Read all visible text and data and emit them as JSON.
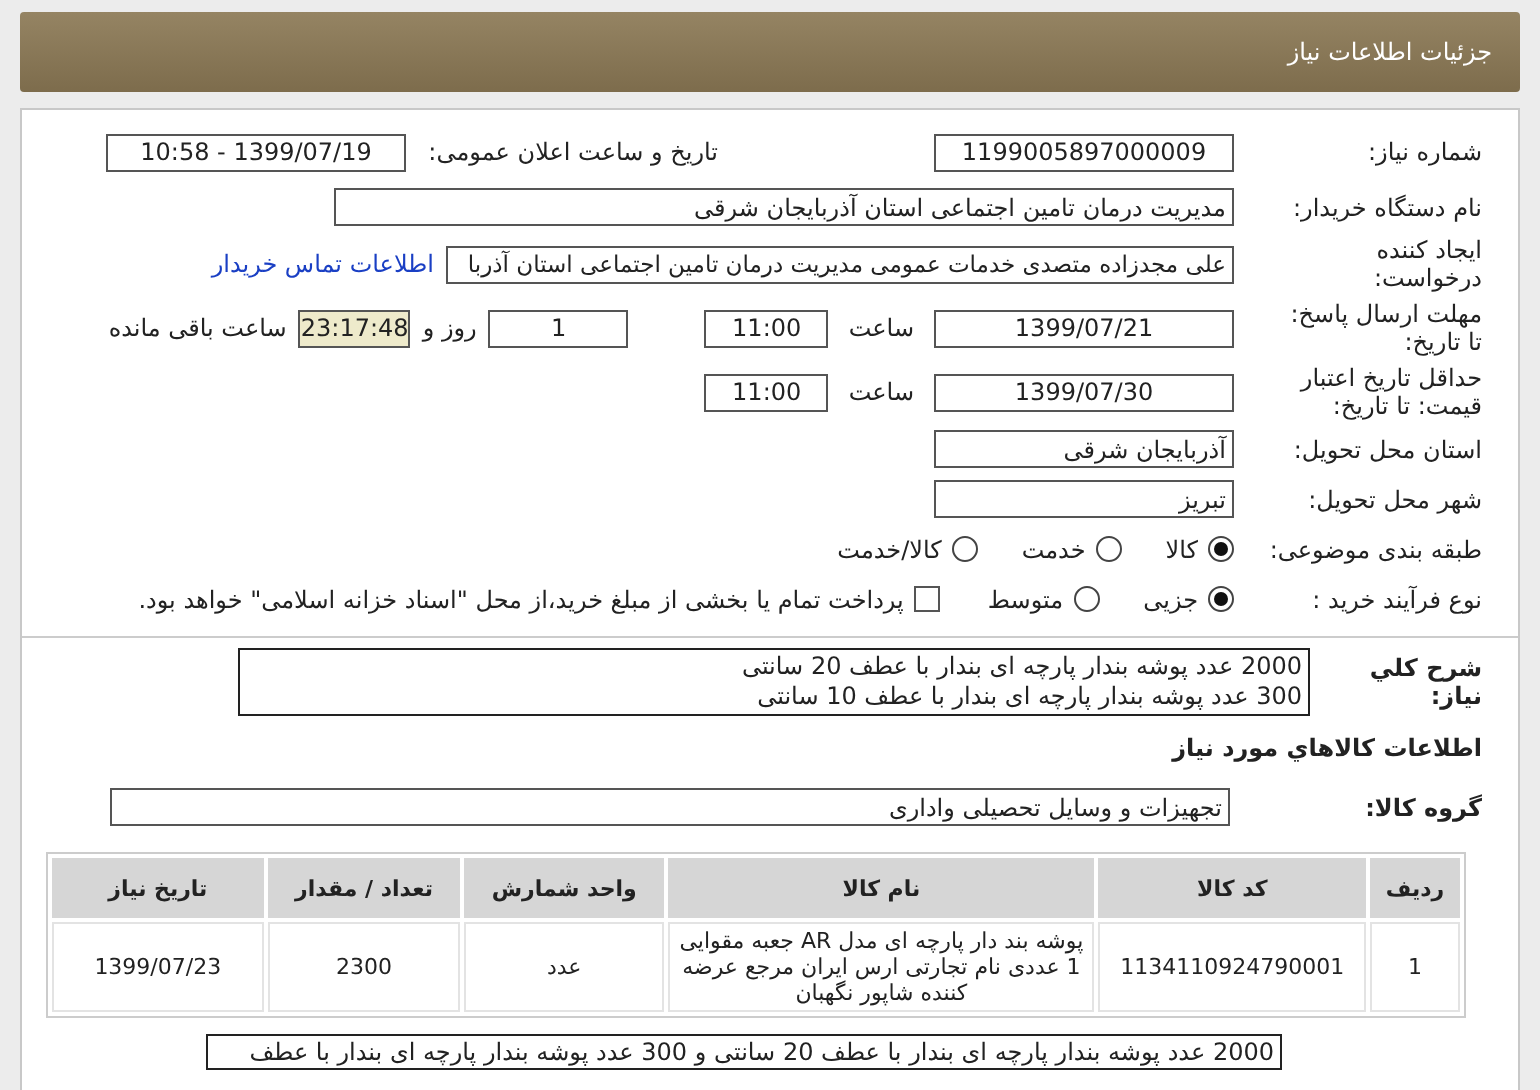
{
  "header": {
    "title": "جزئیات اطلاعات نیاز"
  },
  "need_number": {
    "label": "شماره نیاز:",
    "value": "1199005897000009"
  },
  "announce": {
    "label": "تاریخ و ساعت اعلان عمومی:",
    "value": "1399/07/19 - 10:58"
  },
  "buyer": {
    "label": "نام دستگاه خریدار:",
    "value": "مدیریت درمان تامین اجتماعی استان آذربایجان شرقی"
  },
  "creator": {
    "label_lines": [
      "ایجاد کننده",
      "درخواست:"
    ],
    "value": "علی مجدزاده متصدی خدمات عمومی مدیریت درمان تامین اجتماعی استان آذربا",
    "link": "اطلاعات تماس خریدار"
  },
  "deadline": {
    "label_lines": [
      "مهلت ارسال پاسخ:",
      "تا تاریخ:"
    ],
    "date": "1399/07/21",
    "time_label": "ساعت",
    "time": "11:00",
    "days": "1",
    "days_label": "روز و",
    "remaining": "23:17:48",
    "remaining_label": "ساعت باقی مانده"
  },
  "validity": {
    "label_lines": [
      "حداقل تاریخ اعتبار",
      "قیمت: تا تاریخ:"
    ],
    "date": "1399/07/30",
    "time_label": "ساعت",
    "time": "11:00"
  },
  "province": {
    "label": "استان محل تحویل:",
    "value": "آذربایجان شرقی"
  },
  "city": {
    "label": "شهر محل تحویل:",
    "value": "تبریز"
  },
  "category": {
    "label": "طبقه بندی موضوعی:",
    "options": [
      {
        "label": "کالا",
        "selected": true
      },
      {
        "label": "خدمت",
        "selected": false
      },
      {
        "label": "کالا/خدمت",
        "selected": false
      }
    ]
  },
  "process": {
    "label": "نوع فرآیند خرید :",
    "options": [
      {
        "label": "جزیی",
        "selected": true
      },
      {
        "label": "متوسط",
        "selected": false
      }
    ],
    "treasury": {
      "label": "پرداخت تمام یا بخشی از مبلغ خرید،از محل \"اسناد خزانه اسلامی\" خواهد بود.",
      "checked": false
    }
  },
  "description": {
    "label": "شرح کلي نياز:",
    "lines": [
      "2000 عدد پوشه بندار پارچه ای بندار با عطف 20 سانتی",
      "300 عدد پوشه بندار پارچه ای بندار با عطف 10 سانتی"
    ]
  },
  "goods_heading": "اطلاعات کالاهاي مورد نياز",
  "goods_group": {
    "label": "گروه کالا:",
    "value": "تجهیزات و وسایل تحصیلی واداری"
  },
  "table": {
    "columns": [
      "ردیف",
      "کد کالا",
      "نام کالا",
      "واحد شمارش",
      "تعداد / مقدار",
      "تاریخ نیاز"
    ],
    "rows": [
      [
        "1",
        "1134110924790001",
        "پوشه بند دار پارچه ای مدل AR جعبه مقوایی 1 عددی نام تجارتی ارس ایران مرجع عرضه کننده شاپور نگهبان",
        "عدد",
        "2300",
        "1399/07/23"
      ]
    ]
  },
  "note": "2000 عدد پوشه بندار پارچه ای بندار با عطف 20 سانتی و 300 عدد پوشه بندار پارچه ای بندار با عطف"
}
